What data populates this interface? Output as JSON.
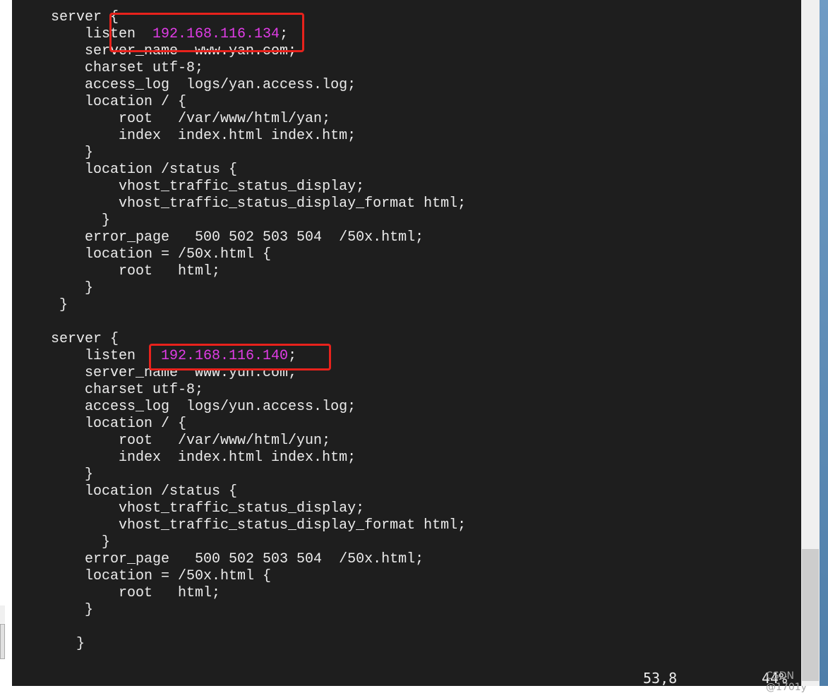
{
  "editor": {
    "lines": [
      {
        "pre": "server {"
      },
      {
        "pre": "    listen  ",
        "ip": "192.168.116.134",
        "post": ";"
      },
      {
        "pre": "    server_name  www.yan.com;"
      },
      {
        "pre": "    charset utf-8;"
      },
      {
        "pre": "    access_log  logs/yan.access.log;"
      },
      {
        "pre": "    location / {"
      },
      {
        "pre": "        root   /var/www/html/yan;"
      },
      {
        "pre": "        index  index.html index.htm;"
      },
      {
        "pre": "    }"
      },
      {
        "pre": "    location /status {"
      },
      {
        "pre": "        vhost_traffic_status_display;"
      },
      {
        "pre": "        vhost_traffic_status_display_format html;"
      },
      {
        "pre": "      }"
      },
      {
        "pre": "    error_page   500 502 503 504  /50x.html;"
      },
      {
        "pre": "    location = /50x.html {"
      },
      {
        "pre": "        root   html;"
      },
      {
        "pre": "    }"
      },
      {
        "pre": " }"
      },
      {
        "pre": ""
      },
      {
        "pre": "server {"
      },
      {
        "pre": "    listen   ",
        "ip": "192.168.116.140",
        "post": ";"
      },
      {
        "pre": "    server_name  www.yun.com;"
      },
      {
        "pre": "    charset utf-8;"
      },
      {
        "pre": "    access_log  logs/yun.access.log;"
      },
      {
        "pre": "    location / {"
      },
      {
        "pre": "        root   /var/www/html/yun;"
      },
      {
        "pre": "        index  index.html index.htm;"
      },
      {
        "pre": "    }"
      },
      {
        "pre": "    location /status {"
      },
      {
        "pre": "        vhost_traffic_status_display;"
      },
      {
        "pre": "        vhost_traffic_status_display_format html;"
      },
      {
        "pre": "      }"
      },
      {
        "pre": "    error_page   500 502 503 504  /50x.html;"
      },
      {
        "pre": "    location = /50x.html {"
      },
      {
        "pre": "        root   html;"
      },
      {
        "pre": "    }"
      },
      {
        "pre": ""
      },
      {
        "pre": "   }"
      }
    ]
  },
  "status": {
    "cursor_position": "53,8",
    "scroll_percent": "44%"
  },
  "watermark": "CSDN @1701y",
  "colors": {
    "background": "#1e1e1e",
    "text": "#ececec",
    "ip_highlight": "#e03ce6",
    "annotation_box": "#e8221c"
  }
}
